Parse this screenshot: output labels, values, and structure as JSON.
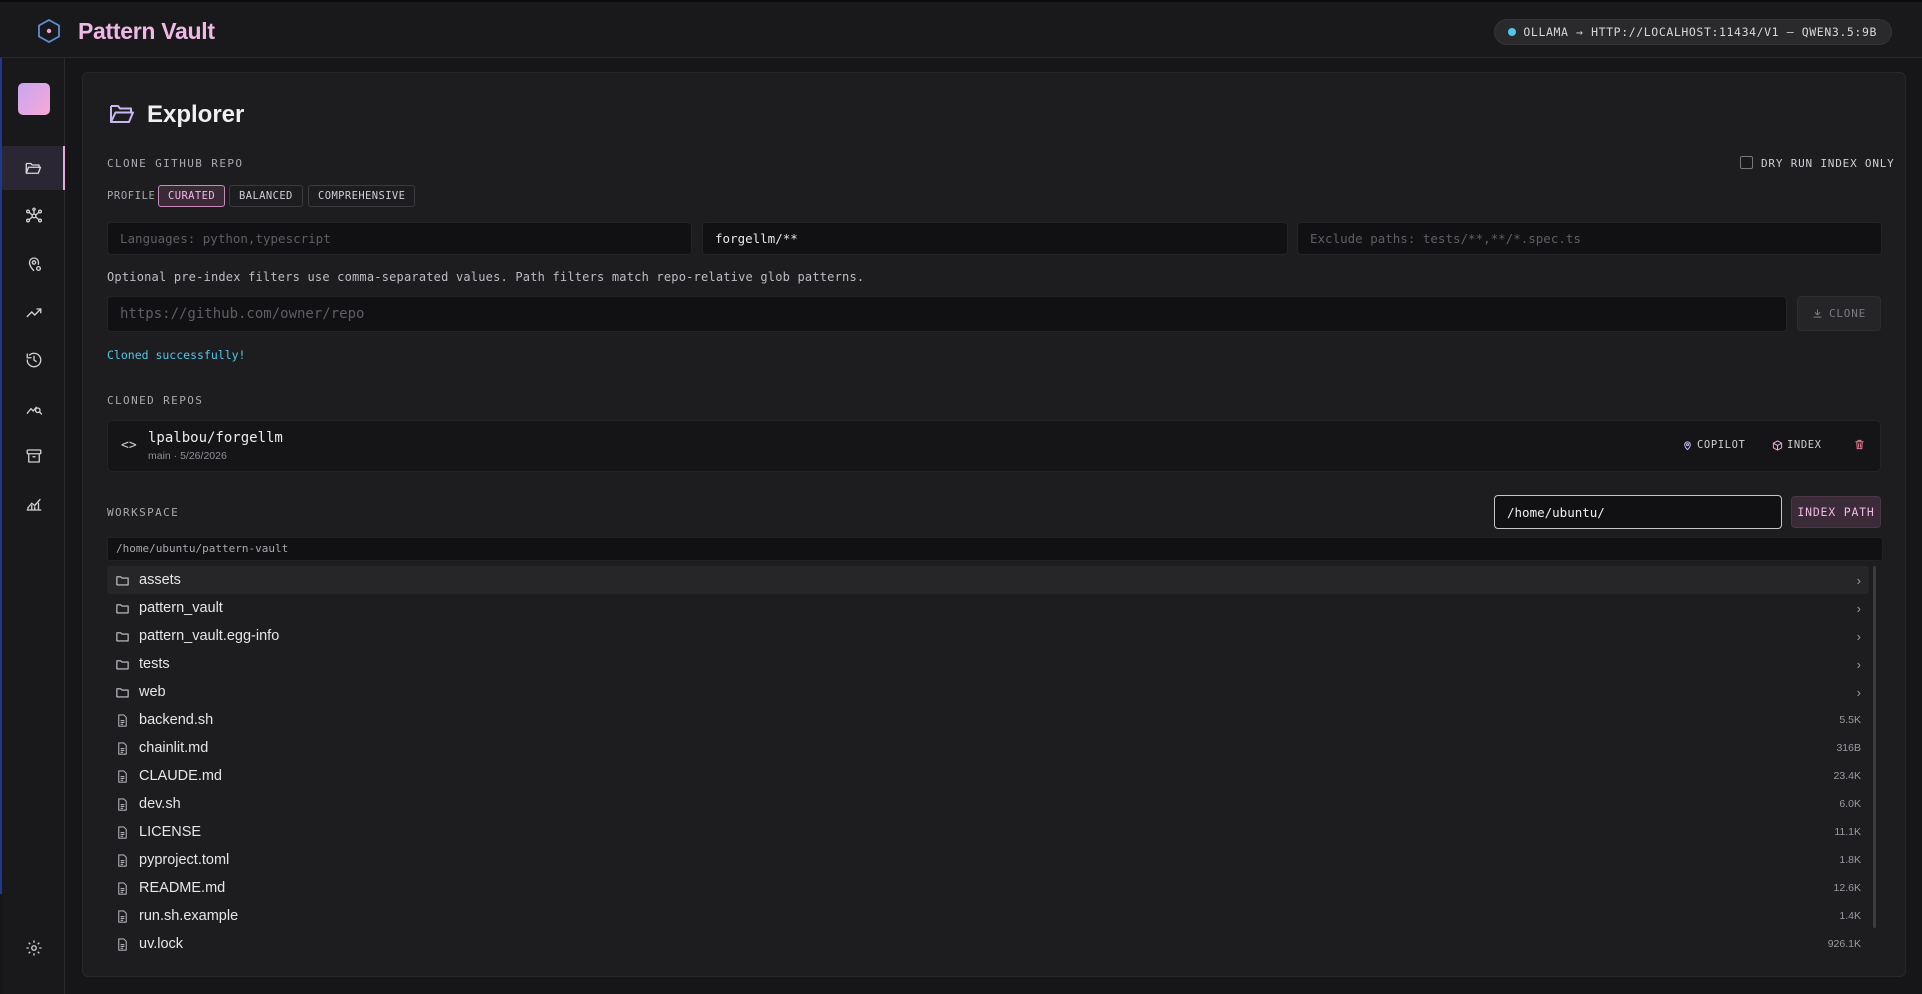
{
  "app": {
    "title": "Pattern Vault",
    "status": "OLLAMA → HTTP://LOCALHOST:11434/V1 — QWEN3.5:9B"
  },
  "sidebar": {
    "items": [
      {
        "name": "explorer",
        "icon": "folder-open-icon",
        "active": true
      },
      {
        "name": "graph",
        "icon": "network-icon"
      },
      {
        "name": "copilot",
        "icon": "brain-pin-icon"
      },
      {
        "name": "trends",
        "icon": "trend-line-icon"
      },
      {
        "name": "history",
        "icon": "history-icon"
      },
      {
        "name": "analysis",
        "icon": "chart-search-icon"
      },
      {
        "name": "archive",
        "icon": "archive-box-icon"
      },
      {
        "name": "metrics",
        "icon": "area-chart-icon"
      }
    ],
    "settings_icon": "gear-icon"
  },
  "explorer": {
    "title": "Explorer",
    "clone_section_label": "CLONE GITHUB REPO",
    "dry_run_label": "DRY RUN INDEX ONLY",
    "profile_label": "PROFILE",
    "profiles": [
      "CURATED",
      "BALANCED",
      "COMPREHENSIVE"
    ],
    "selected_profile": "CURATED",
    "languages_placeholder": "Languages: python,typescript",
    "include_paths_value": "forgellm/**",
    "exclude_paths_placeholder": "Exclude paths: tests/**,**/*.spec.ts",
    "help_text": "Optional pre-index filters use comma-separated values. Path filters match repo-relative glob patterns.",
    "repo_url_placeholder": "https://github.com/owner/repo",
    "clone_button": "CLONE",
    "success_message": "Cloned successfully!"
  },
  "cloned_repos": {
    "label": "CLONED REPOS",
    "repos": [
      {
        "name": "lpalbou/forgellm",
        "meta": "main · 5/26/2026",
        "copilot_label": "COPILOT",
        "index_label": "INDEX"
      }
    ]
  },
  "workspace": {
    "label": "WORKSPACE",
    "path_input_value": "/home/ubuntu/",
    "index_path_button": "INDEX PATH",
    "current_path": "/home/ubuntu/pattern-vault",
    "entries": [
      {
        "name": "assets",
        "type": "folder",
        "size": ""
      },
      {
        "name": "pattern_vault",
        "type": "folder",
        "size": ""
      },
      {
        "name": "pattern_vault.egg-info",
        "type": "folder",
        "size": ""
      },
      {
        "name": "tests",
        "type": "folder",
        "size": ""
      },
      {
        "name": "web",
        "type": "folder",
        "size": ""
      },
      {
        "name": "backend.sh",
        "type": "file",
        "size": "5.5K"
      },
      {
        "name": "chainlit.md",
        "type": "file",
        "size": "316B"
      },
      {
        "name": "CLAUDE.md",
        "type": "file",
        "size": "23.4K"
      },
      {
        "name": "dev.sh",
        "type": "file",
        "size": "6.0K"
      },
      {
        "name": "LICENSE",
        "type": "file",
        "size": "11.1K"
      },
      {
        "name": "pyproject.toml",
        "type": "file",
        "size": "1.8K"
      },
      {
        "name": "README.md",
        "type": "file",
        "size": "12.6K"
      },
      {
        "name": "run.sh.example",
        "type": "file",
        "size": "1.4K"
      },
      {
        "name": "uv.lock",
        "type": "file",
        "size": "926.1K"
      }
    ]
  }
}
